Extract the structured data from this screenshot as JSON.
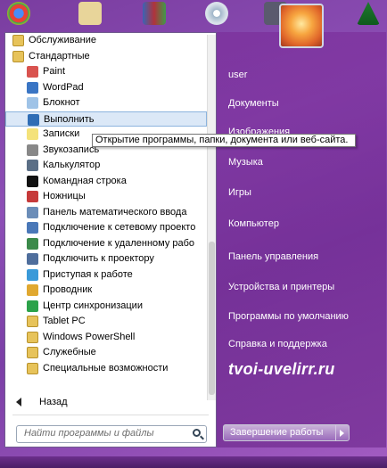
{
  "programs": [
    {
      "label": "Обслуживание",
      "icon": "folder-icon",
      "indent": 0
    },
    {
      "label": "Стандартные",
      "icon": "folder-icon",
      "indent": 0
    },
    {
      "label": "Paint",
      "icon": "paint-icon",
      "indent": 1
    },
    {
      "label": "WordPad",
      "icon": "wordpad-icon",
      "indent": 1
    },
    {
      "label": "Блокнот",
      "icon": "notepad-icon",
      "indent": 1
    },
    {
      "label": "Выполнить",
      "icon": "run-icon",
      "indent": 1,
      "selected": true
    },
    {
      "label": "Записки",
      "icon": "sticky-notes-icon",
      "indent": 1
    },
    {
      "label": "Звукозапись",
      "icon": "microphone-icon",
      "indent": 1
    },
    {
      "label": "Калькулятор",
      "icon": "calculator-icon",
      "indent": 1
    },
    {
      "label": "Командная строка",
      "icon": "command-prompt-icon",
      "indent": 1
    },
    {
      "label": "Ножницы",
      "icon": "scissors-icon",
      "indent": 1
    },
    {
      "label": "Панель математического ввода",
      "icon": "math-input-icon",
      "indent": 1
    },
    {
      "label": "Подключение к сетевому проекто",
      "icon": "network-projector-icon",
      "indent": 1
    },
    {
      "label": "Подключение к удаленному рабо",
      "icon": "remote-desktop-icon",
      "indent": 1
    },
    {
      "label": "Подключить к проектору",
      "icon": "projector-icon",
      "indent": 1
    },
    {
      "label": "Приступая к работе",
      "icon": "getting-started-icon",
      "indent": 1
    },
    {
      "label": "Проводник",
      "icon": "explorer-icon",
      "indent": 1
    },
    {
      "label": "Центр синхронизации",
      "icon": "sync-center-icon",
      "indent": 1
    },
    {
      "label": "Tablet PC",
      "icon": "folder-icon",
      "indent": 1
    },
    {
      "label": "Windows PowerShell",
      "icon": "folder-icon",
      "indent": 1
    },
    {
      "label": "Служебные",
      "icon": "folder-icon",
      "indent": 1
    },
    {
      "label": "Специальные возможности",
      "icon": "folder-icon",
      "indent": 1
    }
  ],
  "back_label": "Назад",
  "search_placeholder": "Найти программы и файлы",
  "tooltip": "Открытие программы, папки, документа или веб-сайта.",
  "right_menu": [
    {
      "label": "user",
      "key": "user"
    },
    {
      "label": "Документы",
      "key": "documents"
    },
    {
      "label": "Изображения",
      "key": "pictures"
    },
    {
      "label": "Музыка",
      "key": "music"
    },
    {
      "label": "Игры",
      "key": "games"
    },
    {
      "label": "Компьютер",
      "key": "computer"
    },
    {
      "label": "Панель управления",
      "key": "control-panel"
    },
    {
      "label": "Устройства и принтеры",
      "key": "devices-printers"
    },
    {
      "label": "Программы по умолчанию",
      "key": "default-programs"
    },
    {
      "label": "Справка и поддержка",
      "key": "help-support"
    }
  ],
  "shutdown_label": "Завершение работы",
  "watermark": "tvoi-uvelirr.ru",
  "colors": {
    "accent": "#8d4fb6",
    "selection": "#dbe8f7",
    "folder": "#e7c35a"
  }
}
